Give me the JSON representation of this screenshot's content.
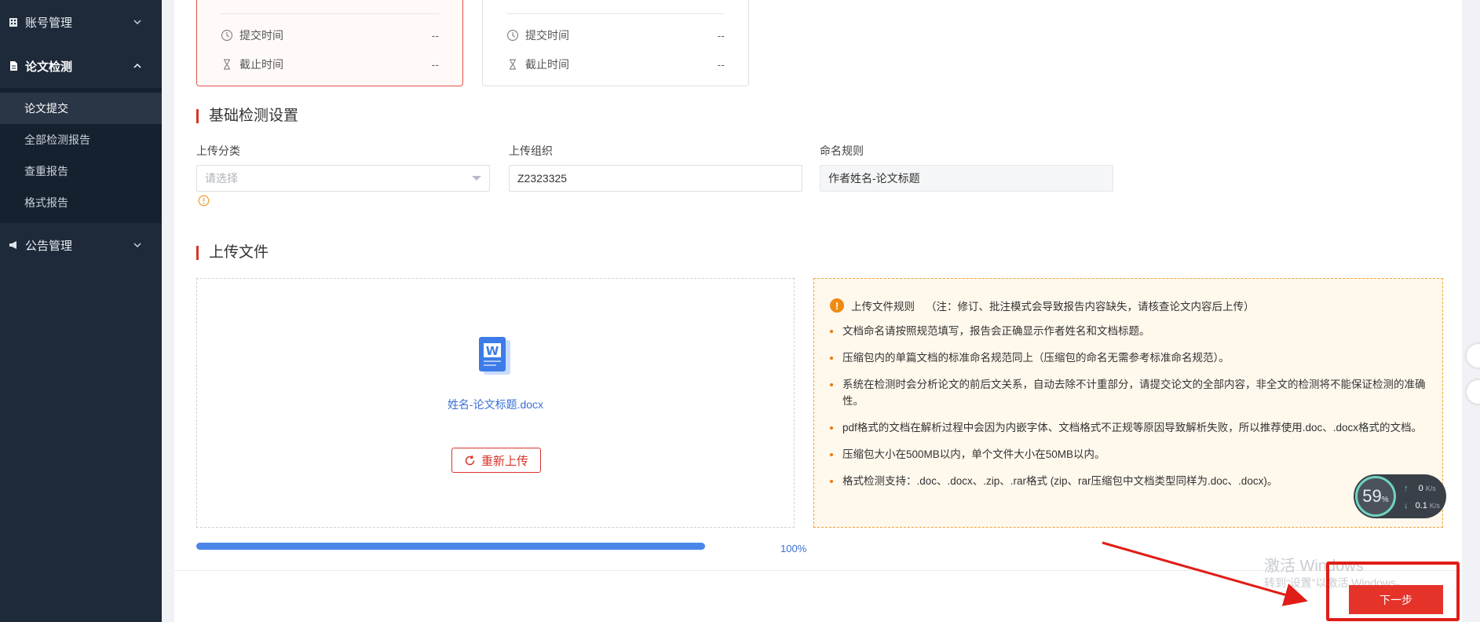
{
  "sidebar": {
    "groups": [
      {
        "label": "账号管理",
        "icon": "building-icon"
      },
      {
        "label": "论文检测",
        "icon": "document-icon"
      },
      {
        "label": "公告管理",
        "icon": "megaphone-icon"
      }
    ],
    "submenu": [
      {
        "label": "论文提交"
      },
      {
        "label": "全部检测报告"
      },
      {
        "label": "查重报告"
      },
      {
        "label": "格式报告"
      }
    ]
  },
  "cards": [
    {
      "submit_label": "提交时间",
      "submit_value": "--",
      "deadline_label": "截止时间",
      "deadline_value": "--"
    },
    {
      "submit_label": "提交时间",
      "submit_value": "--",
      "deadline_label": "截止时间",
      "deadline_value": "--"
    }
  ],
  "basic_settings": {
    "title": "基础检测设置",
    "category_label": "上传分类",
    "category_placeholder": "请选择",
    "org_label": "上传组织",
    "org_value": "Z2323325",
    "naming_label": "命名规则",
    "naming_value": "作者姓名-论文标题"
  },
  "upload": {
    "title": "上传文件",
    "file_name": "姓名-论文标题.docx",
    "reupload_label": "重新上传",
    "progress": 1.0,
    "progress_text": "100%"
  },
  "rules": {
    "title": "上传文件规则",
    "note": "（注：修订、批注模式会导致报告内容缺失，请核查论文内容后上传）",
    "items": [
      "文档命名请按照规范填写，报告会正确显示作者姓名和文档标题。",
      "压缩包内的单篇文档的标准命名规范同上（压缩包的命名无需参考标准命名规范）。",
      "系统在检测时会分析论文的前后文关系，自动去除不计重部分，请提交论文的全部内容，非全文的检测将不能保证检测的准确性。",
      "pdf格式的文档在解析过程中会因为内嵌字体、文档格式不正规等原因导致解析失败，所以推荐使用.doc、.docx格式的文档。",
      "压缩包大小在500MB以内，单个文件大小在50MB以内。",
      "格式检测支持：.doc、.docx、.zip、.rar格式 (zip、rar压缩包中文档类型同样为.doc、.docx)。"
    ]
  },
  "next_button_label": "下一步",
  "watermark": {
    "line1": "激活 Windows",
    "line2": "转到“设置”以激活 Windows。"
  },
  "speed_widget": {
    "percent": "59",
    "percent_unit": "%",
    "up_value": "0",
    "down_value": "0.1",
    "unit": "K/s"
  },
  "colors": {
    "sidebar_bg": "#1e2a3a",
    "accent_red": "#e5332a",
    "link_blue": "#3b6fd4",
    "warning_orange": "#f08b12"
  }
}
